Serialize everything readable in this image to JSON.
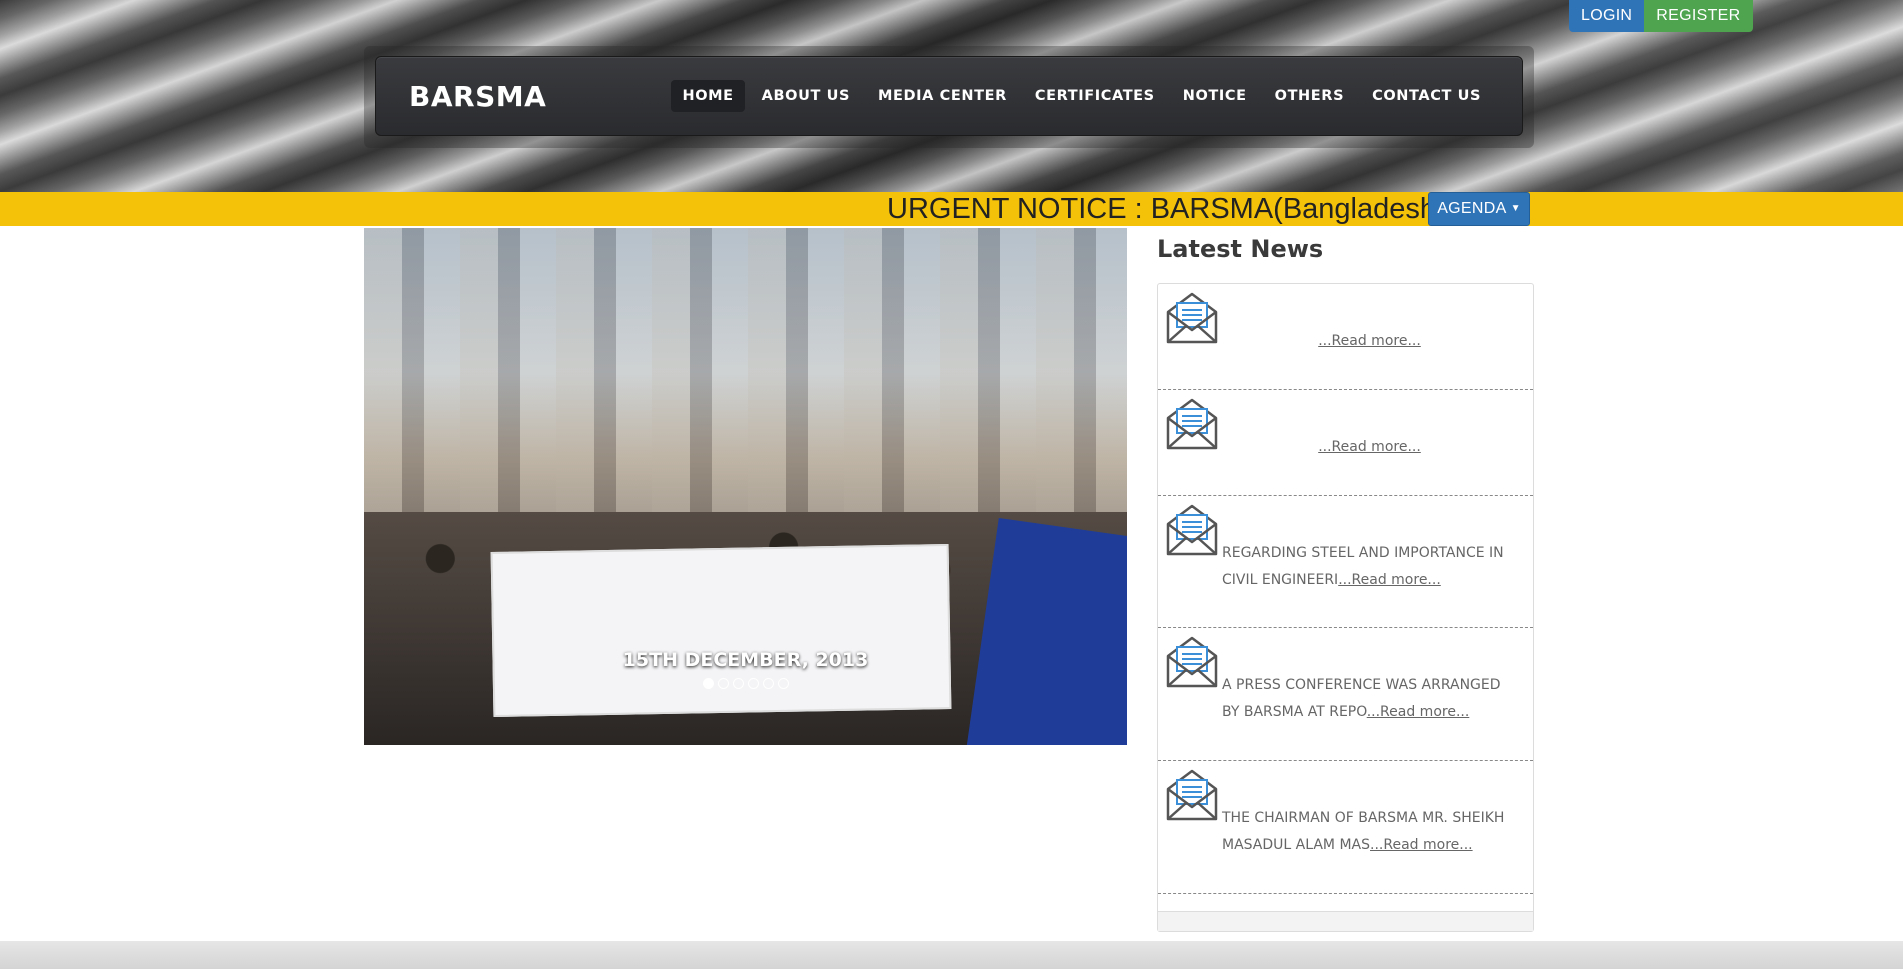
{
  "auth": {
    "login_label": "LOGIN",
    "register_label": "REGISTER"
  },
  "navbar": {
    "brand": "BARSMA",
    "links": [
      {
        "label": "HOME",
        "active": true
      },
      {
        "label": "ABOUT US"
      },
      {
        "label": "MEDIA CENTER"
      },
      {
        "label": "CERTIFICATES"
      },
      {
        "label": "NOTICE"
      },
      {
        "label": "OTHERS"
      },
      {
        "label": "CONTACT US"
      }
    ]
  },
  "ticker": {
    "text": "URGENT NOTICE : BARSMA(Bangladesh A",
    "agenda_label": "AGENDA",
    "bar_color": "#f5c20a"
  },
  "slider": {
    "caption": "15TH DECEMBER, 2013",
    "slide_count": 6,
    "active_index": 0
  },
  "news": {
    "title": "Latest News",
    "items": [
      {
        "text": "",
        "read_more": "...Read more..."
      },
      {
        "text": "",
        "read_more": "...Read more..."
      },
      {
        "text": "REGARDING STEEL AND IMPORTANCE IN CIVIL ENGINEERI",
        "read_more": "...Read more..."
      },
      {
        "text": "A PRESS CONFERENCE WAS ARRANGED BY BARSMA AT REPO",
        "read_more": "...Read more..."
      },
      {
        "text": "THE CHAIRMAN OF BARSMA MR. SHEIKH MASADUL ALAM MAS",
        "read_more": "...Read more..."
      }
    ],
    "icon": "envelope-icon"
  },
  "colors": {
    "primary_blue": "#3074b8",
    "success_green": "#4fa44f",
    "navbar_dark": "#2a2b2e"
  }
}
